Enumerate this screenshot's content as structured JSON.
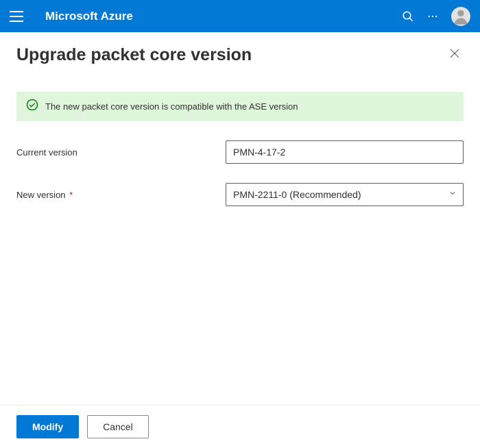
{
  "header": {
    "brand": "Microsoft Azure"
  },
  "page": {
    "title": "Upgrade packet core version"
  },
  "notice": {
    "text": "The new packet core version is compatible with the ASE version"
  },
  "form": {
    "current_version_label": "Current version",
    "current_version_value": "PMN-4-17-2",
    "new_version_label": "New version",
    "new_version_value": "PMN-2211-0 (Recommended)"
  },
  "footer": {
    "modify_label": "Modify",
    "cancel_label": "Cancel"
  }
}
